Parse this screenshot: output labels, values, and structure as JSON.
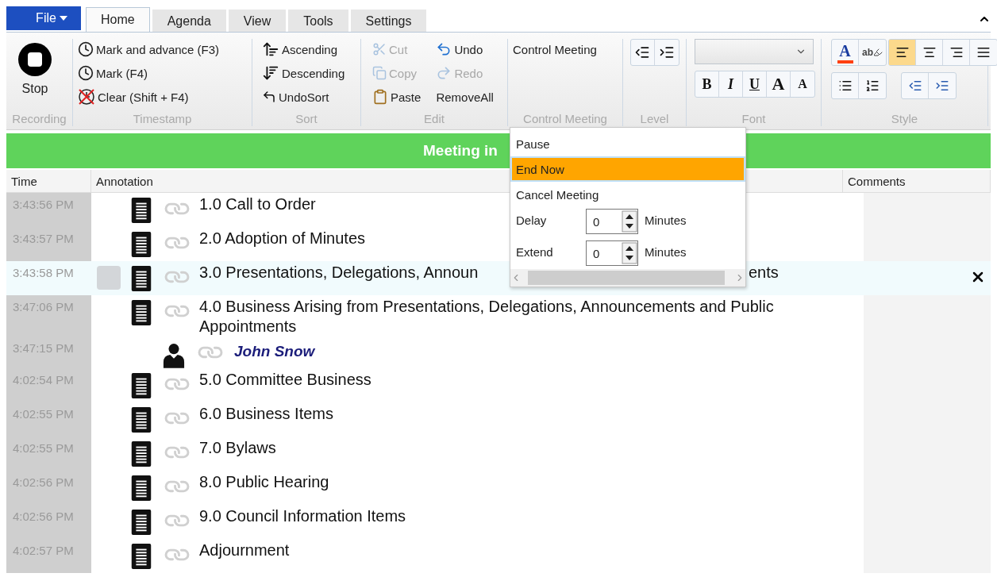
{
  "file_menu": {
    "label": "File"
  },
  "tabs": [
    {
      "label": "Home",
      "selected": true
    },
    {
      "label": "Agenda",
      "selected": false
    },
    {
      "label": "View",
      "selected": false
    },
    {
      "label": "Tools",
      "selected": false
    },
    {
      "label": "Settings",
      "selected": false
    }
  ],
  "ribbon": {
    "groups": [
      {
        "kind": "recording",
        "title": "Recording",
        "buttons": [
          {
            "label": "Stop"
          }
        ]
      },
      {
        "kind": "timestamp",
        "title": "Timestamp",
        "buttons": [
          {
            "label": "Mark and advance (F3)"
          },
          {
            "label": "Mark (F4)"
          },
          {
            "label": "Clear (Shift + F4)"
          }
        ]
      },
      {
        "kind": "sort",
        "title": "Sort",
        "buttons": [
          {
            "label": "Ascending"
          },
          {
            "label": "Descending"
          },
          {
            "label": "UndoSort"
          }
        ]
      },
      {
        "kind": "edit",
        "title": "Edit",
        "buttons": [
          {
            "label": "Cut",
            "disabled": true
          },
          {
            "label": "Undo",
            "disabled": false
          },
          {
            "label": "Copy",
            "disabled": true
          },
          {
            "label": "Redo",
            "disabled": true
          },
          {
            "label": "Paste",
            "disabled": false
          },
          {
            "label": "RemoveAll",
            "disabled": false
          }
        ]
      },
      {
        "kind": "control",
        "title": "Control Meeting",
        "buttons": [
          {
            "label": "Control Meeting",
            "expanded": true
          }
        ]
      },
      {
        "kind": "level",
        "title": "Level"
      },
      {
        "kind": "font",
        "title": "Font",
        "buttons": [
          {
            "label": "B"
          },
          {
            "label": "I"
          },
          {
            "label": "U"
          },
          {
            "label": "A"
          },
          {
            "label": "A"
          }
        ]
      },
      {
        "kind": "style",
        "title": "Style",
        "font_color": {
          "label": "A"
        },
        "highlight": {
          "label": "ab"
        },
        "alignment": [
          {
            "selected": true
          },
          {
            "selected": false
          },
          {
            "selected": false
          },
          {
            "selected": false
          }
        ]
      }
    ]
  },
  "banner": {
    "text": "Meeting in"
  },
  "control_menu": {
    "items": [
      {
        "kind": "action",
        "label": "Pause",
        "selected": false
      },
      {
        "kind": "action",
        "label": "End Now",
        "selected": true
      },
      {
        "kind": "action",
        "label": "Cancel Meeting",
        "selected": false
      },
      {
        "kind": "spinner",
        "label": "Delay",
        "value": "0",
        "unit": "Minutes"
      },
      {
        "kind": "spinner",
        "label": "Extend",
        "value": "0",
        "unit": "Minutes"
      }
    ]
  },
  "table": {
    "columns": [
      "Time",
      "Annotation",
      "Comments"
    ],
    "rows": [
      {
        "time": "3:43:56 PM",
        "kind": "item",
        "text": "1.0 Call to Order",
        "selected": false
      },
      {
        "time": "3:43:57 PM",
        "kind": "item",
        "text": "2.0 Adoption of Minutes",
        "selected": false
      },
      {
        "time": "3:43:58 PM",
        "kind": "item",
        "text": "3.0 Presentations, Delegations, Announ",
        "text_tail": "ents",
        "selected": true
      },
      {
        "time": "3:47:06 PM",
        "kind": "item",
        "text": "4.0 Business Arising from Presentations, Delegations, Announcements and Public Appointments",
        "selected": false
      },
      {
        "time": "3:47:15 PM",
        "kind": "speaker",
        "text": "John Snow",
        "selected": false
      },
      {
        "time": "4:02:54 PM",
        "kind": "item",
        "text": "5.0 Committee Business",
        "selected": false
      },
      {
        "time": "4:02:55 PM",
        "kind": "item",
        "text": "6.0 Business Items",
        "selected": false
      },
      {
        "time": "4:02:55 PM",
        "kind": "item",
        "text": "7.0 Bylaws",
        "selected": false
      },
      {
        "time": "4:02:56 PM",
        "kind": "item",
        "text": "8.0 Public Hearing",
        "selected": false
      },
      {
        "time": "4:02:56 PM",
        "kind": "item",
        "text": "9.0 Council Information Items",
        "selected": false
      },
      {
        "time": "4:02:57 PM",
        "kind": "item",
        "text": "Adjournment",
        "selected": false
      }
    ]
  }
}
